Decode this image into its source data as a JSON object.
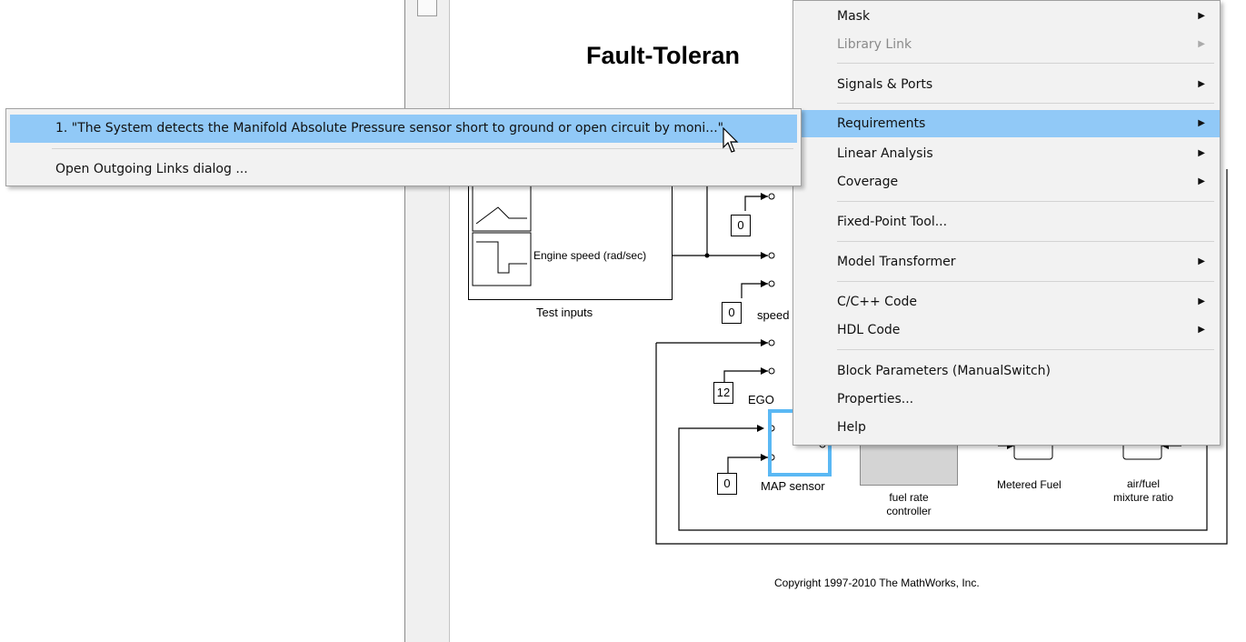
{
  "model": {
    "title": "Fault-Toleran",
    "test_inputs_label": "Test inputs",
    "engine_speed_label": "Engine speed (rad/sec)",
    "const_top": "0",
    "const_speed": "0",
    "speed_label": "speed",
    "const_ego": "12",
    "ego_label": "EGO",
    "const_map": "0",
    "map_label": "MAP sensor",
    "fuel_rate_label": "fuel rate\ncontroller",
    "metered_fuel_label": "Metered Fuel",
    "air_fuel_label": "air/fuel\nmixture ratio",
    "copyright": "Copyright 1997-2010 The MathWorks, Inc."
  },
  "context_menu": {
    "items": [
      {
        "label": "Mask",
        "submenu": true,
        "disabled": false
      },
      {
        "label": "Library Link",
        "submenu": true,
        "disabled": true
      },
      {
        "label": "Signals & Ports",
        "submenu": true,
        "disabled": false
      },
      {
        "label": "Requirements",
        "submenu": true,
        "disabled": false,
        "highlighted": true
      },
      {
        "label": "Linear Analysis",
        "submenu": true,
        "disabled": false
      },
      {
        "label": "Coverage",
        "submenu": true,
        "disabled": false
      },
      {
        "label": "Fixed-Point Tool...",
        "submenu": false,
        "disabled": false
      },
      {
        "label": "Model Transformer",
        "submenu": true,
        "disabled": false
      },
      {
        "label": "C/C++ Code",
        "submenu": true,
        "disabled": false
      },
      {
        "label": "HDL Code",
        "submenu": true,
        "disabled": false
      },
      {
        "label": "Block Parameters (ManualSwitch)",
        "submenu": false,
        "disabled": false
      },
      {
        "label": "Properties...",
        "submenu": false,
        "disabled": false
      },
      {
        "label": "Help",
        "submenu": false,
        "disabled": false
      }
    ],
    "submenu_arrow": "▶"
  },
  "requirements_submenu": {
    "items": [
      {
        "label": "1. \"The System detects the Manifold Absolute Pressure sensor short to ground or open circuit by moni...\""
      },
      {
        "label": "Open Outgoing Links dialog ..."
      }
    ]
  }
}
